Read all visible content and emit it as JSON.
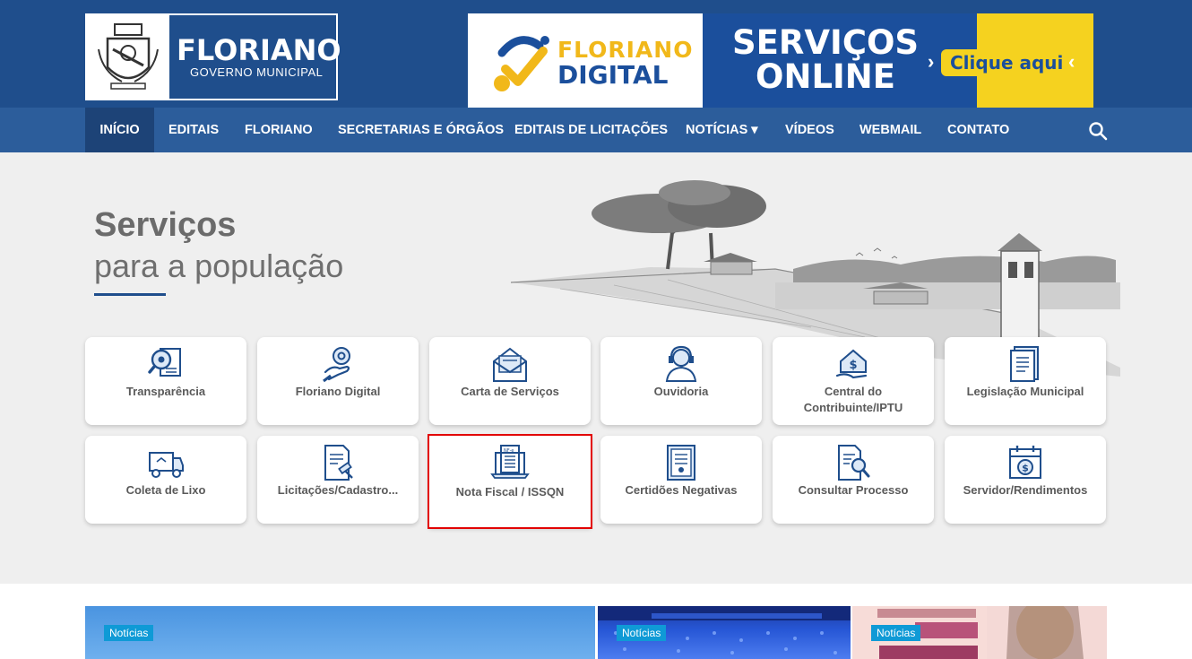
{
  "header": {
    "logo_title": "FLORIANO",
    "logo_subtitle": "GOVERNO MUNICIPAL",
    "banner": {
      "brand_top": "FLORIANO",
      "brand_bottom": "DIGITAL",
      "headline_line1": "SERVIÇOS",
      "headline_line2": "ONLINE",
      "cta": "Clique aqui"
    }
  },
  "nav": {
    "items": [
      {
        "label": "INÍCIO",
        "active": true
      },
      {
        "label": "EDITAIS"
      },
      {
        "label": "FLORIANO"
      },
      {
        "label": "SECRETARIAS E ÓRGÃOS"
      },
      {
        "label": "EDITAIS DE LICITAÇÕES"
      },
      {
        "label": "NOTÍCIAS ▾"
      },
      {
        "label": "VÍDEOS"
      },
      {
        "label": "WEBMAIL"
      },
      {
        "label": "CONTATO"
      }
    ],
    "search_icon": "search-icon"
  },
  "hero": {
    "title": "Serviços",
    "subtitle": "para a população"
  },
  "services": [
    {
      "label": "Transparência",
      "icon": "magnifier-document-icon"
    },
    {
      "label": "Floriano Digital",
      "icon": "hand-gear-icon"
    },
    {
      "label": "Carta de Serviços",
      "icon": "envelope-icon"
    },
    {
      "label": "Ouvidoria",
      "icon": "headset-agent-icon"
    },
    {
      "label": "Central do Contribuinte/IPTU",
      "icon": "house-money-icon"
    },
    {
      "label": "Legislação Municipal",
      "icon": "law-book-icon"
    },
    {
      "label": "Coleta de Lixo",
      "icon": "garbage-truck-icon"
    },
    {
      "label": "Licitações/Cadastro...",
      "icon": "gavel-document-icon"
    },
    {
      "label": "Nota Fiscal / ISSQN",
      "icon": "invoice-laptop-icon"
    },
    {
      "label": "Certidões Negativas",
      "icon": "certificate-icon"
    },
    {
      "label": "Consultar Processo",
      "icon": "search-document-icon"
    },
    {
      "label": "Servidor/Rendimentos",
      "icon": "calendar-money-icon"
    }
  ],
  "news": [
    {
      "badge": "Notícias"
    },
    {
      "badge": "Notícias"
    },
    {
      "badge": "Notícias"
    }
  ],
  "colors": {
    "header_blue": "#1f4e8c",
    "nav_blue": "#2c5d9b",
    "nav_active": "#1d4377",
    "badge_blue": "#0f9ad6",
    "highlight_red": "#e20000",
    "banner_yellow": "#f5d21f"
  }
}
